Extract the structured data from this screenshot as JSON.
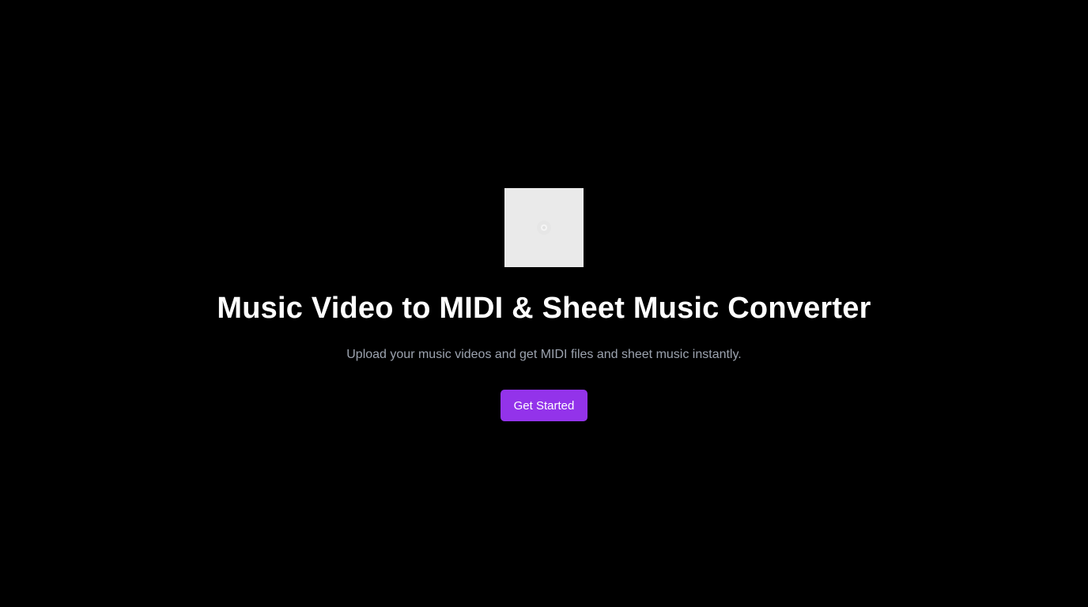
{
  "hero": {
    "image": {
      "icon": "loading-spinner-icon",
      "background_color": "#eaeaea"
    },
    "title": "Music Video to MIDI & Sheet Music Converter",
    "subtitle": "Upload your music videos and get MIDI files and sheet music instantly.",
    "cta_label": "Get Started"
  },
  "colors": {
    "background": "#000000",
    "title": "#ffffff",
    "subtitle": "#9ca3af",
    "accent": "#9333ea"
  }
}
